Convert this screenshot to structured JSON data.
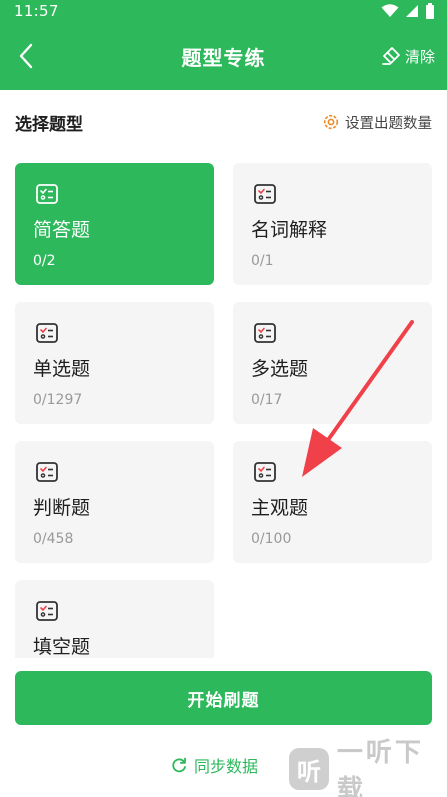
{
  "status": {
    "time": "11:57"
  },
  "header": {
    "title": "题型专练",
    "clear_label": "清除"
  },
  "section": {
    "title": "选择题型",
    "settings_label": "设置出题数量"
  },
  "question_types": [
    {
      "name": "简答题",
      "count": "0/2",
      "selected": true
    },
    {
      "name": "名词解释",
      "count": "0/1",
      "selected": false
    },
    {
      "name": "单选题",
      "count": "0/1297",
      "selected": false
    },
    {
      "name": "多选题",
      "count": "0/17",
      "selected": false
    },
    {
      "name": "判断题",
      "count": "0/458",
      "selected": false
    },
    {
      "name": "主观题",
      "count": "0/100",
      "selected": false
    },
    {
      "name": "填空题",
      "count": "",
      "selected": false
    }
  ],
  "actions": {
    "start_label": "开始刷题",
    "sync_label": "同步数据"
  },
  "watermark": {
    "logo": "听",
    "text": "一听下载"
  },
  "colors": {
    "primary": "#2eb85c",
    "card_bg": "#f5f5f5",
    "arrow": "#f0414b"
  },
  "icons": {
    "back": "chevron-left-icon",
    "clear": "eraser-icon",
    "settings": "gear-icon",
    "card": "checklist-icon",
    "sync": "refresh-icon"
  }
}
